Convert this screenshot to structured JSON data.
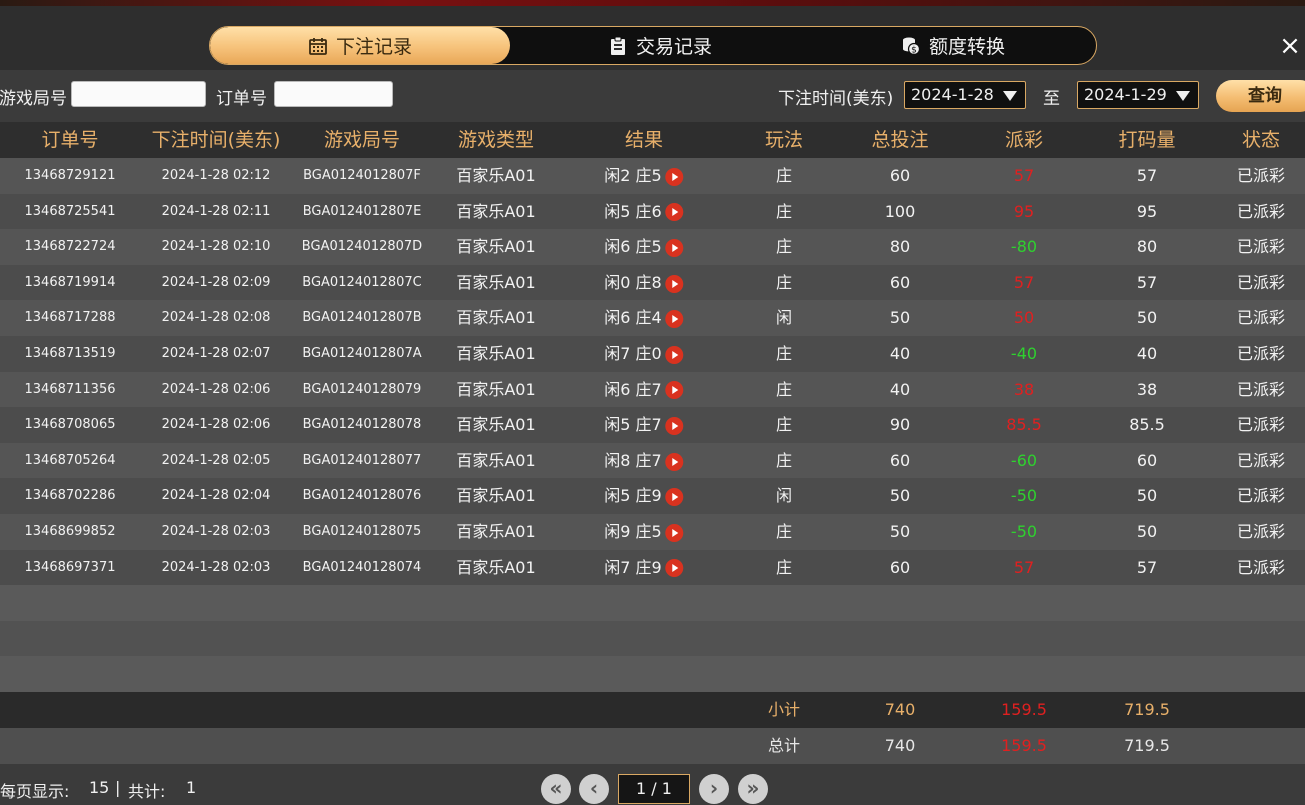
{
  "tabs": [
    {
      "label": "下注记录",
      "icon": "calendar-icon",
      "active": true
    },
    {
      "label": "交易记录",
      "icon": "clipboard-icon",
      "active": false
    },
    {
      "label": "额度转换",
      "icon": "coins-icon",
      "active": false
    }
  ],
  "close_label": "×",
  "filters": {
    "game_round_label": "游戏局号",
    "game_round_value": "",
    "order_label": "订单号",
    "order_value": "",
    "time_label": "下注时间(美东)",
    "date_from": "2024-1-28",
    "to_label": "至",
    "date_to": "2024-1-29",
    "query_label": "查询"
  },
  "columns": [
    "订单号",
    "下注时间(美东)",
    "游戏局号",
    "游戏类型",
    "结果",
    "玩法",
    "总投注",
    "派彩",
    "打码量",
    "状态"
  ],
  "rows": [
    {
      "order": "13468729121",
      "time": "2024-1-28 02:12",
      "round": "BGA0124012807F",
      "game": "百家乐A01",
      "result": "闲2 庄5",
      "play": "庄",
      "bet": "60",
      "payout": "57",
      "payout_color": "red",
      "valid": "57",
      "status": "已派彩"
    },
    {
      "order": "13468725541",
      "time": "2024-1-28 02:11",
      "round": "BGA0124012807E",
      "game": "百家乐A01",
      "result": "闲5 庄6",
      "play": "庄",
      "bet": "100",
      "payout": "95",
      "payout_color": "red",
      "valid": "95",
      "status": "已派彩"
    },
    {
      "order": "13468722724",
      "time": "2024-1-28 02:10",
      "round": "BGA0124012807D",
      "game": "百家乐A01",
      "result": "闲6 庄5",
      "play": "庄",
      "bet": "80",
      "payout": "-80",
      "payout_color": "green",
      "valid": "80",
      "status": "已派彩"
    },
    {
      "order": "13468719914",
      "time": "2024-1-28 02:09",
      "round": "BGA0124012807C",
      "game": "百家乐A01",
      "result": "闲0 庄8",
      "play": "庄",
      "bet": "60",
      "payout": "57",
      "payout_color": "red",
      "valid": "57",
      "status": "已派彩"
    },
    {
      "order": "13468717288",
      "time": "2024-1-28 02:08",
      "round": "BGA0124012807B",
      "game": "百家乐A01",
      "result": "闲6 庄4",
      "play": "闲",
      "bet": "50",
      "payout": "50",
      "payout_color": "red",
      "valid": "50",
      "status": "已派彩"
    },
    {
      "order": "13468713519",
      "time": "2024-1-28 02:07",
      "round": "BGA0124012807A",
      "game": "百家乐A01",
      "result": "闲7 庄0",
      "play": "庄",
      "bet": "40",
      "payout": "-40",
      "payout_color": "green",
      "valid": "40",
      "status": "已派彩"
    },
    {
      "order": "13468711356",
      "time": "2024-1-28 02:06",
      "round": "BGA01240128079",
      "game": "百家乐A01",
      "result": "闲6 庄7",
      "play": "庄",
      "bet": "40",
      "payout": "38",
      "payout_color": "red",
      "valid": "38",
      "status": "已派彩"
    },
    {
      "order": "13468708065",
      "time": "2024-1-28 02:06",
      "round": "BGA01240128078",
      "game": "百家乐A01",
      "result": "闲5 庄7",
      "play": "庄",
      "bet": "90",
      "payout": "85.5",
      "payout_color": "red",
      "valid": "85.5",
      "status": "已派彩"
    },
    {
      "order": "13468705264",
      "time": "2024-1-28 02:05",
      "round": "BGA01240128077",
      "game": "百家乐A01",
      "result": "闲8 庄7",
      "play": "庄",
      "bet": "60",
      "payout": "-60",
      "payout_color": "green",
      "valid": "60",
      "status": "已派彩"
    },
    {
      "order": "13468702286",
      "time": "2024-1-28 02:04",
      "round": "BGA01240128076",
      "game": "百家乐A01",
      "result": "闲5 庄9",
      "play": "闲",
      "bet": "50",
      "payout": "-50",
      "payout_color": "green",
      "valid": "50",
      "status": "已派彩"
    },
    {
      "order": "13468699852",
      "time": "2024-1-28 02:03",
      "round": "BGA01240128075",
      "game": "百家乐A01",
      "result": "闲9 庄5",
      "play": "庄",
      "bet": "50",
      "payout": "-50",
      "payout_color": "green",
      "valid": "50",
      "status": "已派彩"
    },
    {
      "order": "13468697371",
      "time": "2024-1-28 02:03",
      "round": "BGA01240128074",
      "game": "百家乐A01",
      "result": "闲7 庄9",
      "play": "庄",
      "bet": "60",
      "payout": "57",
      "payout_color": "red",
      "valid": "57",
      "status": "已派彩"
    }
  ],
  "empty_rows": 3,
  "subtotal": {
    "label": "小计",
    "bet": "740",
    "payout": "159.5",
    "valid": "719.5"
  },
  "total": {
    "label": "总计",
    "bet": "740",
    "payout": "159.5",
    "valid": "719.5"
  },
  "footer": {
    "per_page_label": "每页显示:",
    "per_page": "15",
    "separator": "|",
    "total_label": "共计:",
    "total_count": "1",
    "page_current": "1",
    "page_sep": "/",
    "page_total": "1"
  },
  "colors": {
    "accent": "#e8b06a",
    "payout_red": "#e02020",
    "payout_green": "#2fd12f"
  }
}
